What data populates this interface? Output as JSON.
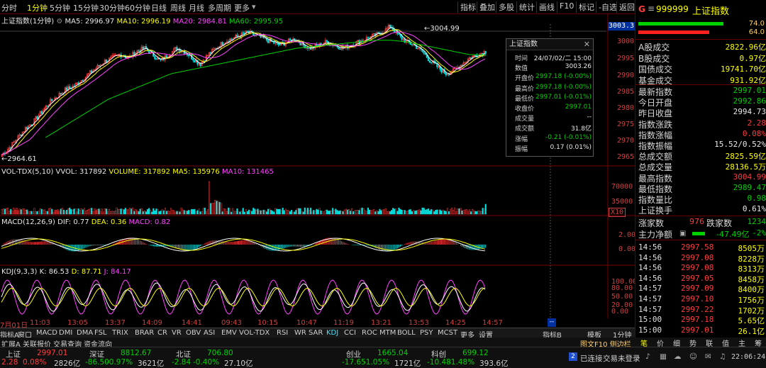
{
  "toolbar": {
    "timeframes": [
      "分时",
      "1分钟",
      "5分钟",
      "15分钟",
      "30分钟",
      "60分钟",
      "日线",
      "周线",
      "月线",
      "多周期",
      "更多"
    ],
    "active_timeframe": "1分钟",
    "right_buttons": [
      "指标",
      "叠加",
      "多股",
      "统计",
      "画线",
      "F10",
      "标记",
      "-自选",
      "返回"
    ]
  },
  "main_chart": {
    "title": "上证指数(1分钟)",
    "ma5_label": "MA5: 2996.97",
    "ma10_label": "MA10: 2996.19",
    "ma20_label": "MA20: 2984.81",
    "ma60_label": "MA60: 2995.95",
    "high_annotation": "3004.99",
    "low_annotation": "2964.61",
    "price_tag": "3003.3",
    "y_ticks": [
      "3000",
      "2995",
      "2990",
      "2985",
      "2980",
      "2975",
      "2970",
      "2965"
    ],
    "colors": {
      "up": "#ff3c3c",
      "down": "#00e0e0",
      "ma5": "#ffffff",
      "ma10": "#ffff00",
      "ma20": "#ff40ff",
      "ma60": "#00d200"
    }
  },
  "chart_data": {
    "type": "candlestick",
    "symbol": "上证指数",
    "period": "1分钟",
    "x_ticks": [
      "7月01日",
      "11:03",
      "13:05",
      "13:37",
      "14:09",
      "14:41",
      "09:43",
      "10:15",
      "10:47",
      "11:19",
      "13:21",
      "13:53",
      "14:25",
      "14:57"
    ],
    "close_path": [
      2964.61,
      2967,
      2970,
      2973,
      2975,
      2978,
      2981,
      2983,
      2985,
      2986,
      2988,
      2990,
      2992,
      2994,
      2995,
      2996,
      2995,
      2997,
      2998,
      2996,
      2994,
      2996,
      2998,
      2997,
      2995,
      2993,
      2996,
      2998,
      3000,
      3001,
      3002,
      3003,
      3002,
      3001,
      3000,
      2999,
      3000,
      3001,
      2999,
      2998,
      2999,
      3000,
      2999,
      2998,
      2999,
      3000,
      3001,
      3002,
      3003,
      3004.99,
      3002,
      3000,
      2999,
      2997,
      2994,
      2992,
      2990,
      2991,
      2993,
      2995,
      2996,
      2997.01
    ],
    "ma60_path": [
      2970,
      2973,
      2976,
      2979,
      2982,
      2984,
      2986,
      2988,
      2990,
      2991,
      2992,
      2993,
      2994,
      2995,
      2996,
      2997,
      2998,
      2998.5,
      2999,
      2999.5,
      3000,
      3000.5,
      3000.5,
      3000,
      2999,
      2998,
      2997,
      2996,
      2995.95
    ],
    "ylim": [
      2962,
      3006
    ]
  },
  "vol_pane": {
    "label": "VOL-TDX(5,10)",
    "vvol": "VVOL: 317892",
    "volume": "VOLUME: 317892",
    "ma5": "MA5: 135976",
    "ma10": "MA10: 131465",
    "y_ticks": [
      "70000",
      "35000"
    ],
    "unit": "X10"
  },
  "macd_pane": {
    "label": "MACD(12,26,9)",
    "dif": "DIF: 0.77",
    "dea": "DEA: 0.36",
    "macd": "MACD: 0.82",
    "y_ticks": [
      "2.00",
      "0.00"
    ]
  },
  "kdj_pane": {
    "label": "KDJ(9,3,3)",
    "k": "K: 86.53",
    "d": "D: 87.71",
    "j": "J: 84.17",
    "y_ticks": [
      "100.00",
      "80.00",
      "50.00",
      "20.00",
      "0.00"
    ]
  },
  "popup": {
    "title": "上证指数",
    "rows": [
      {
        "k": "时间",
        "v": "24/07/02/二 15:00",
        "c": "white"
      },
      {
        "k": "数值",
        "v": "3003.26",
        "c": "white"
      },
      {
        "k": "开盘价",
        "v": "2997.18 (-0.00%)",
        "c": "green"
      },
      {
        "k": "最高价",
        "v": "2997.18 (-0.00%)",
        "c": "green"
      },
      {
        "k": "最低价",
        "v": "2997.01 (-0.01%)",
        "c": "green"
      },
      {
        "k": "收盘价",
        "v": "2997.01",
        "c": "green"
      },
      {
        "k": "成交量",
        "v": "--",
        "c": "white"
      },
      {
        "k": "成交额",
        "v": "31.8亿",
        "c": "white"
      },
      {
        "k": "涨幅",
        "v": "-0.21 (-0.01%)",
        "c": "green"
      },
      {
        "k": "振幅",
        "v": "0.17 (0.01%)",
        "c": "white"
      }
    ]
  },
  "right_panel": {
    "flag": "G",
    "code": "999999",
    "name": "上证指数",
    "bar_values": [
      "74.0",
      "64.0"
    ],
    "turnover": [
      {
        "k": "A股成交",
        "v": "2822.96亿"
      },
      {
        "k": "B股成交",
        "v": "0.97亿"
      },
      {
        "k": "国债成交",
        "v": "19741.70亿"
      },
      {
        "k": "基金成交",
        "v": "931.92亿"
      }
    ],
    "stats": [
      {
        "k": "最新指数",
        "v": "2997.01",
        "c": "green"
      },
      {
        "k": "今日开盘",
        "v": "2992.86",
        "c": "green"
      },
      {
        "k": "昨日收盘",
        "v": "2994.73",
        "c": "white"
      },
      {
        "k": "指数涨跌",
        "v": "2.28",
        "c": "red"
      },
      {
        "k": "指数涨幅",
        "v": "0.08%",
        "c": "red"
      },
      {
        "k": "指数振幅",
        "v": "15.52/0.52%",
        "c": "white"
      },
      {
        "k": "总成交额",
        "v": "2825.59亿",
        "c": "yellow"
      },
      {
        "k": "总成交量",
        "v": "28136.5万",
        "c": "yellow"
      },
      {
        "k": "最高指数",
        "v": "3004.99",
        "c": "red"
      },
      {
        "k": "最低指数",
        "v": "2989.47",
        "c": "green"
      },
      {
        "k": "指数量比",
        "v": "0.98",
        "c": "green"
      },
      {
        "k": "上证换手",
        "v": "0.61%",
        "c": "white"
      }
    ],
    "updown_label": "涨家数",
    "up_count": "976",
    "down_label": "跌家数",
    "down_count": "1234",
    "netflow_label": "主力净额",
    "netflow_value": "-47.49亿",
    "netflow_pct": "-2%",
    "ticks": [
      {
        "t": "14:56",
        "p": "2997.58",
        "v": "8505万"
      },
      {
        "t": "14:56",
        "p": "2997.08",
        "v": "8228万"
      },
      {
        "t": "14:56",
        "p": "2997.08",
        "v": "8313万"
      },
      {
        "t": "14:56",
        "p": "2997.05",
        "v": "8458万"
      },
      {
        "t": "14:57",
        "p": "2997.09",
        "v": "8400万"
      },
      {
        "t": "14:57",
        "p": "2997.10",
        "v": "1756万"
      },
      {
        "t": "14:57",
        "p": "2997.22",
        "v": "1702万"
      },
      {
        "t": "15:00",
        "p": "2997.18",
        "v": "5.65亿"
      },
      {
        "t": "15:00",
        "p": "2997.01",
        "v": "26.1亿"
      }
    ],
    "tabs": [
      "笔",
      "价",
      "细",
      "势",
      "联",
      "值",
      "主",
      "筹"
    ]
  },
  "indicator_bar": {
    "items": [
      "指标A",
      "窗口",
      "MACD",
      "DMI",
      "DMA",
      "FSL",
      "TRIX",
      "BRAR",
      "CR",
      "VR",
      "OBV",
      "ASI",
      "EMV",
      "VOL-TDX",
      "RSI",
      "WR",
      "SAR",
      "KDJ",
      "CCI",
      "ROC",
      "MTM",
      "BOLL",
      "PSY",
      "MCST",
      "更多",
      "设置"
    ],
    "active": "KDJ",
    "right_items": [
      "指标B",
      "模板",
      "1分钟"
    ]
  },
  "nav_bar": {
    "items": [
      "扩展A",
      "关联报价",
      "交易查询",
      "资金流向"
    ],
    "right": "图文F10 侧边栏"
  },
  "status_bar": {
    "indices": [
      {
        "name": "上证",
        "val": "2997.01",
        "chg": "2.28",
        "pct": "0.08%",
        "amt": "2826亿"
      },
      {
        "name": "深证",
        "val": "8812.67",
        "chg": "-86.50",
        "pct": "-0.97%",
        "amt": "3621亿"
      },
      {
        "name": "北证",
        "val": "706.80",
        "chg": "-2.84",
        "pct": "-0.40%",
        "amt": "27.10亿"
      },
      {
        "name": "创业",
        "val": "1665.04",
        "chg": "-17.65",
        "pct": "-1.05%",
        "amt": "1721亿"
      },
      {
        "name": "科创",
        "val": "699.12",
        "chg": "-10.48",
        "pct": "-1.48%",
        "amt": "393.6亿"
      }
    ],
    "badge": "2",
    "connected": "已连接",
    "login": "交易未登录",
    "clock": "22:06:24"
  }
}
